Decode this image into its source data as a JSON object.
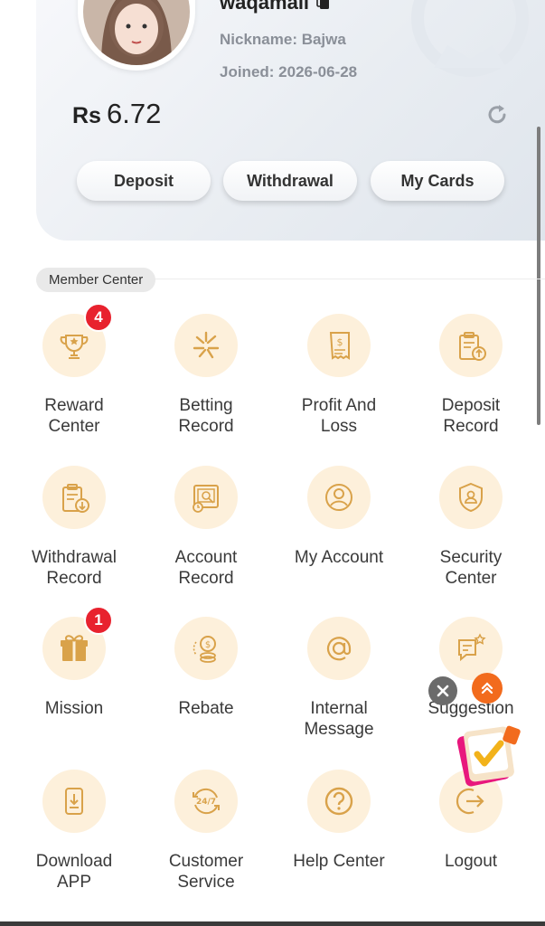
{
  "profile": {
    "username": "waqamali",
    "nickname": "Nickname: Bajwa",
    "joined": "Joined: 2026-06-28",
    "currency": "Rs",
    "balance": "6.72"
  },
  "actions": {
    "deposit": "Deposit",
    "withdrawal": "Withdrawal",
    "my_cards": "My Cards"
  },
  "section": {
    "title": "Member Center"
  },
  "menu": [
    {
      "label": "Reward\nCenter",
      "icon": "trophy-icon",
      "badge": "4"
    },
    {
      "label": "Betting\nRecord",
      "icon": "betting-icon"
    },
    {
      "label": "Profit And\nLoss",
      "icon": "receipt-icon"
    },
    {
      "label": "Deposit\nRecord",
      "icon": "deposit-record-icon"
    },
    {
      "label": "Withdrawal\nRecord",
      "icon": "withdrawal-record-icon"
    },
    {
      "label": "Account\nRecord",
      "icon": "account-record-icon"
    },
    {
      "label": "My Account",
      "icon": "user-icon"
    },
    {
      "label": "Security\nCenter",
      "icon": "shield-icon"
    },
    {
      "label": "Mission",
      "icon": "gift-icon",
      "badge": "1"
    },
    {
      "label": "Rebate",
      "icon": "coins-icon"
    },
    {
      "label": "Internal\nMessage",
      "icon": "at-icon"
    },
    {
      "label": "Suggestion",
      "icon": "suggestion-icon"
    },
    {
      "label": "Download\nAPP",
      "icon": "download-icon"
    },
    {
      "label": "Customer\nService",
      "icon": "support-24-7-icon"
    },
    {
      "label": "Help Center",
      "icon": "question-icon"
    },
    {
      "label": "Logout",
      "icon": "logout-icon"
    }
  ],
  "colors": {
    "icon_bg": "#fdf0db",
    "icon_stroke": "#d9a24a",
    "badge": "#e8222e"
  }
}
